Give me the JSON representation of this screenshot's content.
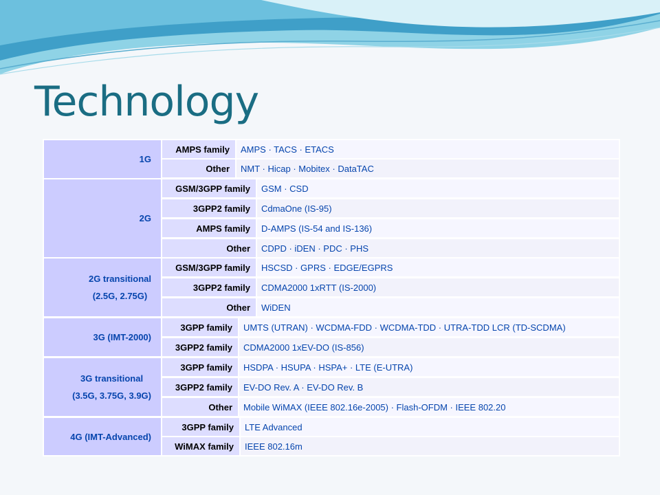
{
  "slide": {
    "title": "Technology"
  },
  "table": {
    "generations": [
      {
        "label": "1G",
        "families": [
          {
            "name": "AMPS family",
            "techs": "AMPS · TACS · ETACS"
          },
          {
            "name": "Other",
            "techs": "NMT · Hicap · Mobitex · DataTAC"
          }
        ]
      },
      {
        "label": "2G",
        "families": [
          {
            "name": "GSM/3GPP family",
            "techs": "GSM · CSD"
          },
          {
            "name": "3GPP2 family",
            "techs": "CdmaOne (IS-95)"
          },
          {
            "name": "AMPS family",
            "techs": "D-AMPS (IS-54 and IS-136)"
          },
          {
            "name": "Other",
            "techs": "CDPD · iDEN · PDC · PHS"
          }
        ]
      },
      {
        "label": "2G transitional",
        "sublabel": "(2.5G, 2.75G)",
        "families": [
          {
            "name": "GSM/3GPP family",
            "techs": "HSCSD · GPRS · EDGE/EGPRS"
          },
          {
            "name": "3GPP2 family",
            "techs": "CDMA2000 1xRTT (IS-2000)"
          },
          {
            "name": "Other",
            "techs": "WiDEN"
          }
        ]
      },
      {
        "label": "3G (IMT-2000)",
        "families": [
          {
            "name": "3GPP family",
            "techs": "UMTS (UTRAN) · WCDMA-FDD · WCDMA-TDD · UTRA-TDD LCR (TD-SCDMA)"
          },
          {
            "name": "3GPP2 family",
            "techs": "CDMA2000 1xEV-DO (IS-856)"
          }
        ]
      },
      {
        "label": "3G transitional",
        "sublabel": "(3.5G, 3.75G, 3.9G)",
        "families": [
          {
            "name": "3GPP family",
            "techs": "HSDPA · HSUPA · HSPA+ · LTE (E-UTRA)"
          },
          {
            "name": "3GPP2 family",
            "techs": "EV-DO Rev. A · EV-DO Rev. B"
          },
          {
            "name": "Other",
            "techs": "Mobile WiMAX (IEEE 802.16e-2005) · Flash-OFDM · IEEE 802.20"
          }
        ]
      },
      {
        "label": "4G (IMT-Advanced)",
        "families": [
          {
            "name": "3GPP family",
            "techs": "LTE Advanced"
          },
          {
            "name": "WiMAX family",
            "techs": "IEEE 802.16m"
          }
        ]
      }
    ]
  }
}
